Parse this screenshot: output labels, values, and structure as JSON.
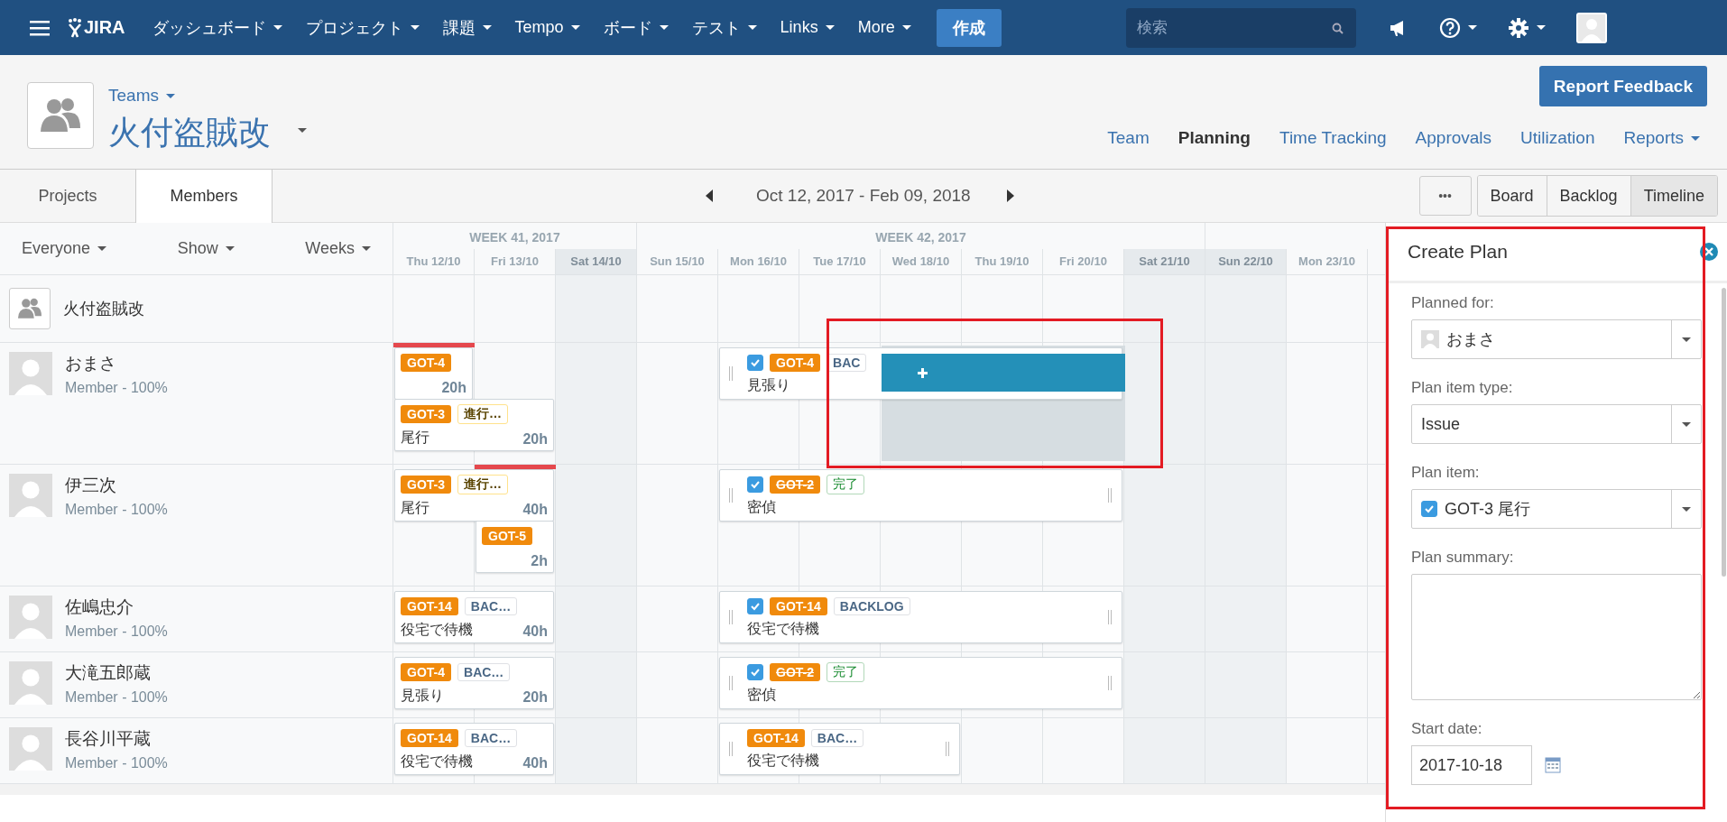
{
  "nav": {
    "logo": "JIRA",
    "menus": [
      "ダッシュボード",
      "プロジェクト",
      "課題",
      "Tempo",
      "ボード",
      "テスト",
      "Links",
      "More"
    ],
    "create": "作成",
    "search": {
      "placeholder": "検索"
    }
  },
  "team_header": {
    "breadcrumb": "Teams",
    "title": "火付盗賊改",
    "report_button": "Report Feedback",
    "tabs": [
      {
        "label": "Team",
        "selected": false,
        "menu": false
      },
      {
        "label": "Planning",
        "selected": true,
        "menu": false
      },
      {
        "label": "Time Tracking",
        "selected": false,
        "menu": false
      },
      {
        "label": "Approvals",
        "selected": false,
        "menu": false
      },
      {
        "label": "Utilization",
        "selected": false,
        "menu": false
      },
      {
        "label": "Reports",
        "selected": false,
        "menu": true
      }
    ]
  },
  "subtabs": [
    {
      "label": "Projects",
      "selected": false
    },
    {
      "label": "Members",
      "selected": true
    }
  ],
  "date_range": "Oct 12, 2017 - Feb 09, 2018",
  "more_button": "•••",
  "views": [
    {
      "label": "Board",
      "selected": false
    },
    {
      "label": "Backlog",
      "selected": false
    },
    {
      "label": "Timeline",
      "selected": true
    }
  ],
  "filters": [
    "Everyone",
    "Show",
    "Weeks"
  ],
  "timeline": {
    "weeks": [
      "WEEK 41, 2017",
      "WEEK 42, 2017"
    ],
    "days": [
      {
        "label": "Thu 12/10",
        "weekend": false
      },
      {
        "label": "Fri 13/10",
        "weekend": false
      },
      {
        "label": "Sat 14/10",
        "weekend": true
      },
      {
        "label": "Sun 15/10",
        "weekend": false
      },
      {
        "label": "Mon 16/10",
        "weekend": false
      },
      {
        "label": "Tue 17/10",
        "weekend": false
      },
      {
        "label": "Wed 18/10",
        "weekend": false
      },
      {
        "label": "Thu 19/10",
        "weekend": false
      },
      {
        "label": "Fri 20/10",
        "weekend": false
      },
      {
        "label": "Sat 21/10",
        "weekend": true
      },
      {
        "label": "Sun 22/10",
        "weekend": true
      },
      {
        "label": "Mon 23/10",
        "weekend": false
      }
    ]
  },
  "team_row": {
    "name": "火付盗賊改"
  },
  "members": [
    {
      "name": "おまさ",
      "role": "Member - 100%",
      "overbooked": true,
      "plans": [
        {
          "kind": "issue",
          "key": "GOT-4",
          "resolved": false,
          "hours": "20h"
        },
        {
          "kind": "issue",
          "key": "GOT-3",
          "resolved": false,
          "status": {
            "text": "進行…",
            "kind": "inprogress"
          },
          "summary": "尾行",
          "hours": "20h"
        },
        {
          "kind": "plan",
          "key": "GOT-4",
          "resolved": false,
          "checked": true,
          "status": {
            "text": "BAC",
            "kind": "backlog"
          },
          "summary": "見張り"
        }
      ]
    },
    {
      "name": "伊三次",
      "role": "Member - 100%",
      "overbooked": true,
      "plans": [
        {
          "kind": "issue",
          "key": "GOT-3",
          "resolved": false,
          "status": {
            "text": "進行…",
            "kind": "inprogress"
          },
          "summary": "尾行",
          "hours": "40h"
        },
        {
          "kind": "issue",
          "key": "GOT-5",
          "resolved": false,
          "hours": "2h"
        },
        {
          "kind": "plan",
          "key": "GOT-2",
          "resolved": true,
          "checked": true,
          "status": {
            "text": "完了",
            "kind": "done"
          },
          "summary": "密偵"
        }
      ]
    },
    {
      "name": "佐嶋忠介",
      "role": "Member - 100%",
      "overbooked": false,
      "plans": [
        {
          "kind": "issue",
          "key": "GOT-14",
          "resolved": false,
          "status": {
            "text": "BAC…",
            "kind": "backlog"
          },
          "summary": "役宅で待機",
          "hours": "40h"
        },
        {
          "kind": "plan",
          "key": "GOT-14",
          "resolved": false,
          "checked": true,
          "status": {
            "text": "BACKLOG",
            "kind": "backlog"
          },
          "summary": "役宅で待機"
        }
      ]
    },
    {
      "name": "大滝五郎蔵",
      "role": "Member - 100%",
      "overbooked": false,
      "plans": [
        {
          "kind": "issue",
          "key": "GOT-4",
          "resolved": false,
          "status": {
            "text": "BAC…",
            "kind": "backlog"
          },
          "summary": "見張り",
          "hours": "20h"
        },
        {
          "kind": "plan",
          "key": "GOT-2",
          "resolved": true,
          "checked": true,
          "status": {
            "text": "完了",
            "kind": "done"
          },
          "summary": "密偵"
        }
      ]
    },
    {
      "name": "長谷川平蔵",
      "role": "Member - 100%",
      "overbooked": false,
      "plans": [
        {
          "kind": "issue",
          "key": "GOT-14",
          "resolved": false,
          "status": {
            "text": "BAC…",
            "kind": "backlog"
          },
          "summary": "役宅で待機",
          "hours": "40h"
        },
        {
          "kind": "moved",
          "key": "GOT-14",
          "resolved": false,
          "status": {
            "text": "BAC…",
            "kind": "backlog"
          },
          "summary": "役宅で待機"
        }
      ]
    }
  ],
  "create_plan": {
    "title": "Create Plan",
    "fields": [
      {
        "kind": "user-select",
        "label": "Planned for:",
        "value": "おまさ"
      },
      {
        "kind": "select",
        "label": "Plan item type:",
        "value": "Issue"
      },
      {
        "kind": "issue-select",
        "label": "Plan item:",
        "value": "GOT-3 尾行",
        "checked": true
      },
      {
        "kind": "textarea",
        "label": "Plan summary:"
      },
      {
        "kind": "date",
        "label": "Start date:",
        "value": "2017-10-18"
      }
    ]
  }
}
